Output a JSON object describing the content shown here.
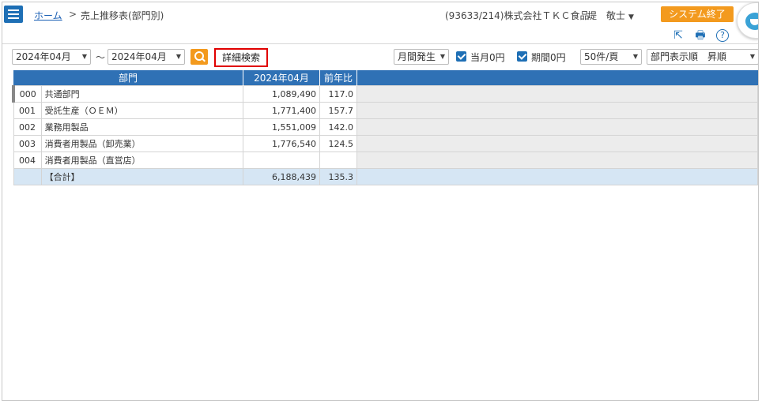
{
  "header": {
    "breadcrumb_home": "ホーム",
    "breadcrumb_sep": ">",
    "breadcrumb_current": "売上推移表(部門別)",
    "company": "(93633/214)株式会社ＴＫＣ食品",
    "user": "堤　敬士",
    "exit_label": "システム終了"
  },
  "icons": [
    "menu-icon",
    "export-icon",
    "print-icon",
    "help-icon",
    "search-icon",
    "avatar-icon"
  ],
  "filters": {
    "from_month": "2024年04月",
    "range_sep": "～",
    "to_month": "2024年04月",
    "advanced_search": "詳細検索",
    "mode": "月間発生",
    "show_current_zero": "当月0円",
    "show_period_zero": "期間0円",
    "page_size": "50件/頁",
    "sort_order": "部門表示順　昇順"
  },
  "table": {
    "columns": [
      "部門",
      "2024年04月",
      "前年比"
    ],
    "rows": [
      {
        "code": "000",
        "name": "共通部門",
        "value": "1,089,490",
        "ratio": "117.0"
      },
      {
        "code": "001",
        "name": "受託生産（ＯＥＭ）",
        "value": "1,771,400",
        "ratio": "157.7"
      },
      {
        "code": "002",
        "name": "業務用製品",
        "value": "1,551,009",
        "ratio": "142.0"
      },
      {
        "code": "003",
        "name": "消費者用製品（卸売業）",
        "value": "1,776,540",
        "ratio": "124.5"
      },
      {
        "code": "004",
        "name": "消費者用製品（直営店）",
        "value": "",
        "ratio": ""
      }
    ],
    "total": {
      "code": "",
      "name": "【合計】",
      "value": "6,188,439",
      "ratio": "135.3"
    }
  },
  "colors": {
    "accent": "#1e6fb5",
    "orange": "#f39a1e",
    "highlight_border": "#e00000",
    "total_row": "#d6e6f4"
  }
}
